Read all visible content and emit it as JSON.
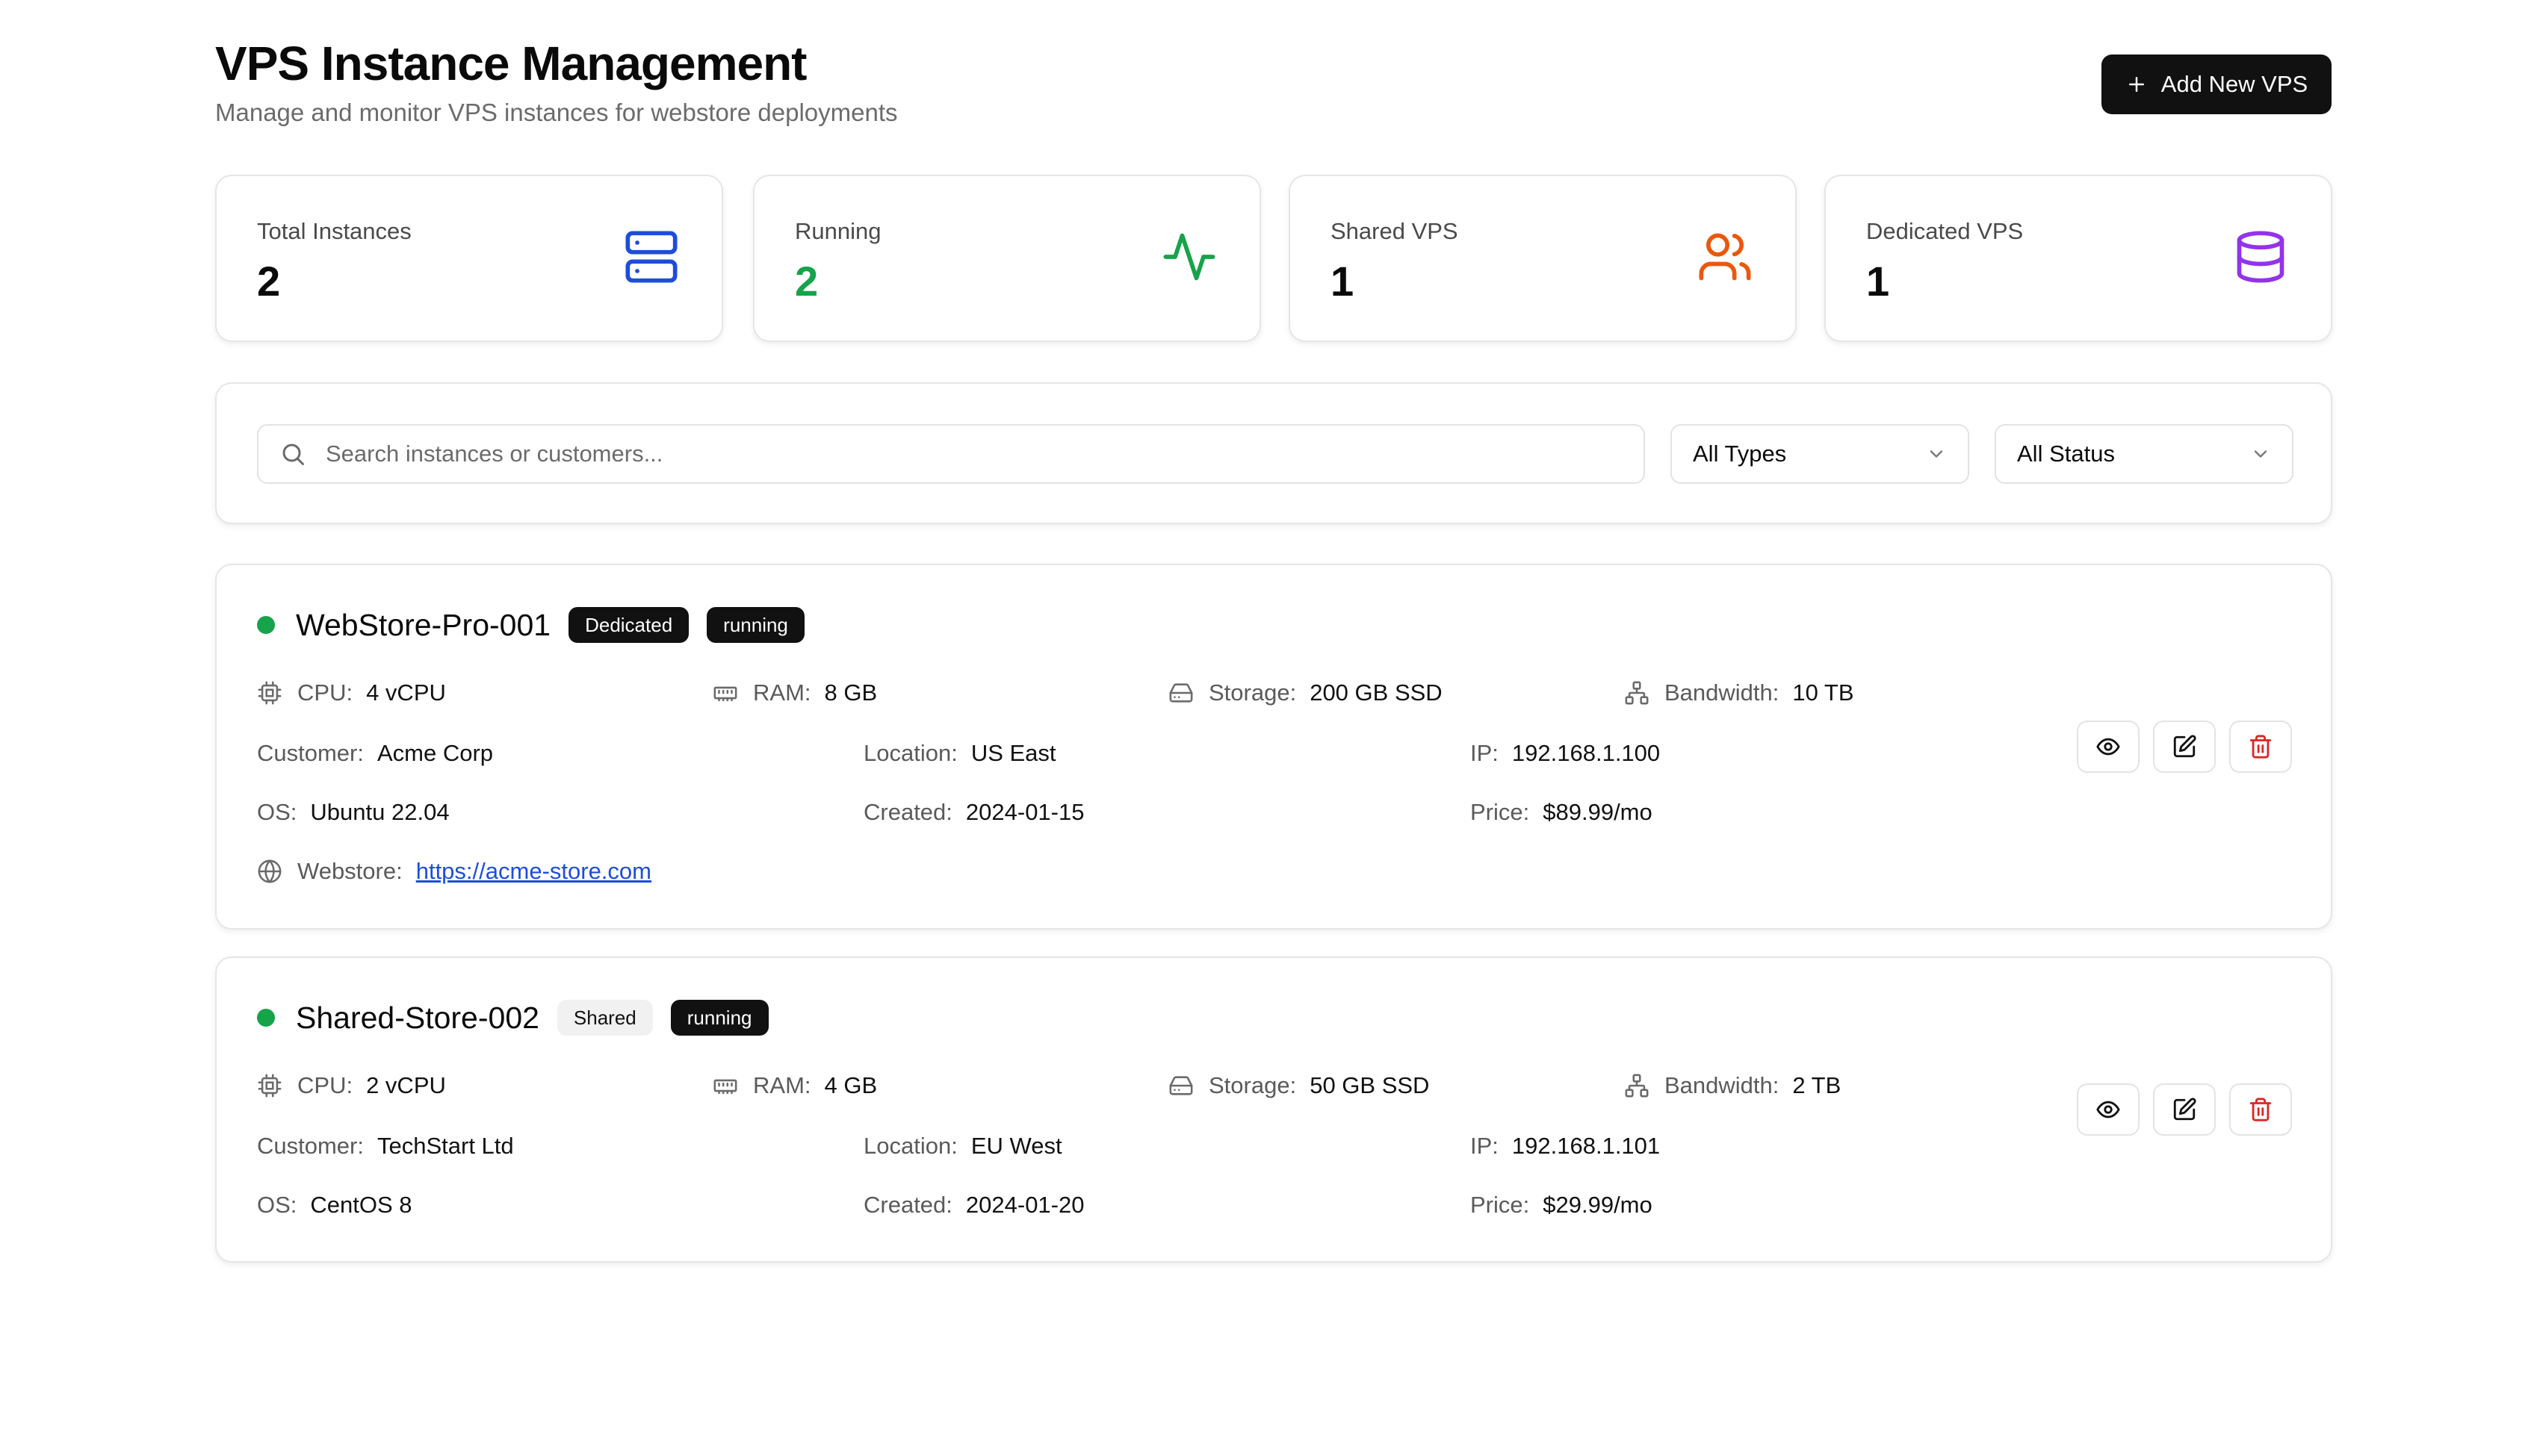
{
  "header": {
    "title": "VPS Instance Management",
    "subtitle": "Manage and monitor VPS instances for webstore deployments",
    "add_button_label": "Add New VPS"
  },
  "stats": [
    {
      "label": "Total Instances",
      "value": "2",
      "icon": "server-icon",
      "color": "#1d4ed8"
    },
    {
      "label": "Running",
      "value": "2",
      "icon": "activity-icon",
      "color": "#16a34a"
    },
    {
      "label": "Shared VPS",
      "value": "1",
      "icon": "users-icon",
      "color": "#ea580c"
    },
    {
      "label": "Dedicated VPS",
      "value": "1",
      "icon": "database-icon",
      "color": "#9333ea"
    }
  ],
  "filters": {
    "search_placeholder": "Search instances or customers...",
    "search_value": "",
    "type_selected": "All Types",
    "status_selected": "All Status"
  },
  "labels": {
    "cpu": "CPU:",
    "ram": "RAM:",
    "storage": "Storage:",
    "bandwidth": "Bandwidth:",
    "customer": "Customer:",
    "location": "Location:",
    "ip": "IP:",
    "os": "OS:",
    "created": "Created:",
    "price": "Price:",
    "webstore": "Webstore:"
  },
  "instances": [
    {
      "name": "WebStore-Pro-001",
      "type": "Dedicated",
      "status": "running",
      "status_color": "#16a34a",
      "cpu": "4 vCPU",
      "ram": "8 GB",
      "storage": "200 GB SSD",
      "bandwidth": "10 TB",
      "customer": "Acme Corp",
      "location": "US East",
      "ip": "192.168.1.100",
      "os": "Ubuntu 22.04",
      "created": "2024-01-15",
      "price": "$89.99/mo",
      "webstore": "https://acme-store.com"
    },
    {
      "name": "Shared-Store-002",
      "type": "Shared",
      "status": "running",
      "status_color": "#16a34a",
      "cpu": "2 vCPU",
      "ram": "4 GB",
      "storage": "50 GB SSD",
      "bandwidth": "2 TB",
      "customer": "TechStart Ltd",
      "location": "EU West",
      "ip": "192.168.1.101",
      "os": "CentOS 8",
      "created": "2024-01-20",
      "price": "$29.99/mo"
    }
  ],
  "colors": {
    "primary": "#111111",
    "danger": "#dc2626",
    "link": "#1d4ed8"
  }
}
